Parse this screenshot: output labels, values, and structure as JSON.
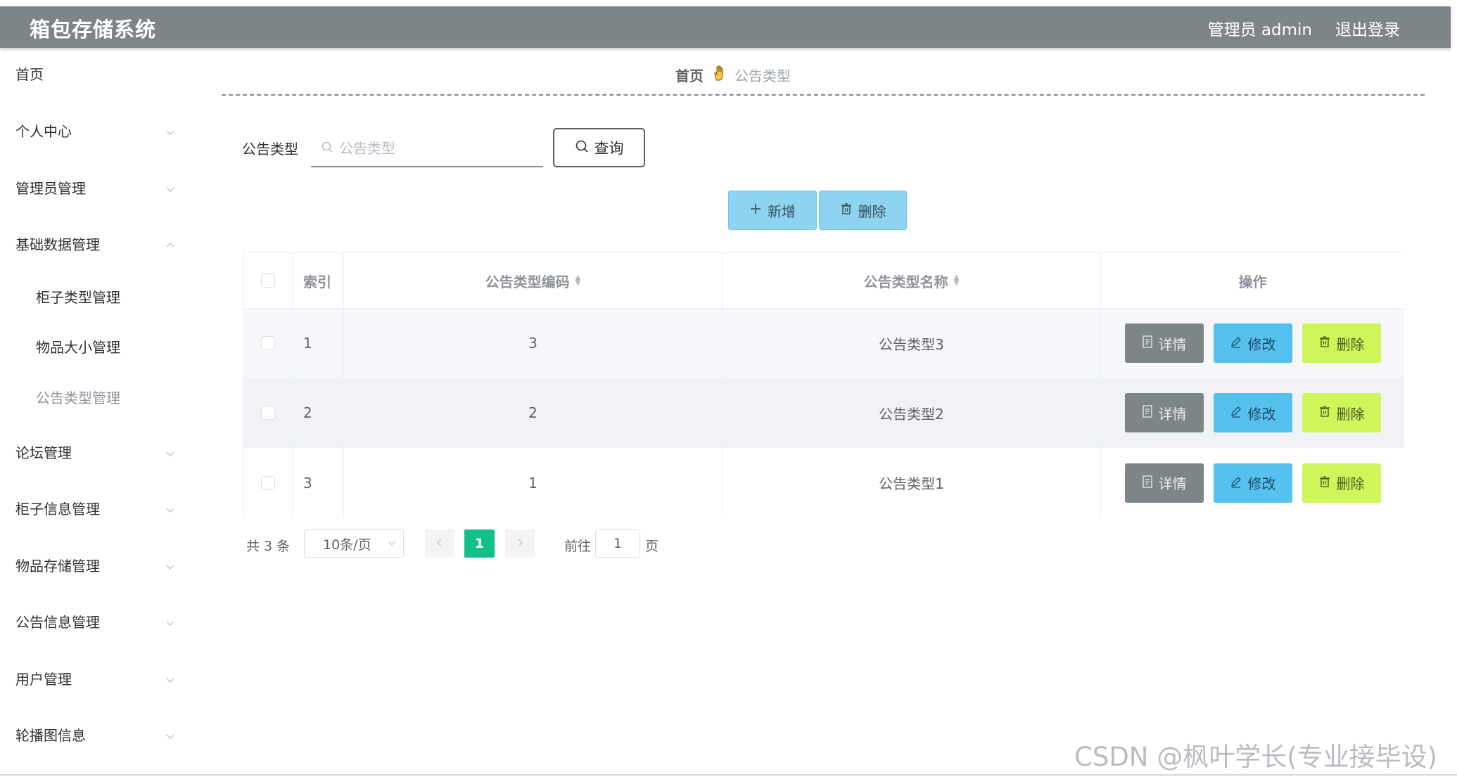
{
  "header": {
    "brand": "箱包存储系统",
    "user": "管理员 admin",
    "logout": "退出登录",
    "bg_color": "#7d8589"
  },
  "sidebar": {
    "items": [
      {
        "label": "首页",
        "chevron": false
      },
      {
        "label": "个人中心",
        "chevron": "down"
      },
      {
        "label": "管理员管理",
        "chevron": "down"
      },
      {
        "label": "基础数据管理",
        "chevron": "up"
      },
      {
        "label": "论坛管理",
        "chevron": "down"
      },
      {
        "label": "柜子信息管理",
        "chevron": "down"
      },
      {
        "label": "物品存储管理",
        "chevron": "down"
      },
      {
        "label": "公告信息管理",
        "chevron": "down"
      },
      {
        "label": "用户管理",
        "chevron": "down"
      },
      {
        "label": "轮播图信息",
        "chevron": "down"
      }
    ],
    "submenu": [
      {
        "label": "柜子类型管理",
        "active": false
      },
      {
        "label": "物品大小管理",
        "active": false
      },
      {
        "label": "公告类型管理",
        "active": true
      }
    ]
  },
  "breadcrumb": {
    "home": "首页",
    "current": "公告类型"
  },
  "search": {
    "label": "公告类型",
    "placeholder": "公告类型",
    "value": "",
    "query_label": "查询"
  },
  "toolbar": {
    "add_label": "新增",
    "delete_label": "删除",
    "button_color": "#8ed3ef"
  },
  "table": {
    "columns": [
      "索引",
      "公告类型编码",
      "公告类型名称",
      "操作"
    ],
    "rows": [
      {
        "index": "1",
        "code": "3",
        "name": "公告类型3"
      },
      {
        "index": "2",
        "code": "2",
        "name": "公告类型2"
      },
      {
        "index": "3",
        "code": "1",
        "name": "公告类型1"
      }
    ],
    "actions": {
      "detail": "详情",
      "edit": "修改",
      "delete": "删除"
    },
    "action_colors": {
      "detail": "#7d8589",
      "edit": "#56c0ef",
      "delete": "#cdf65a"
    }
  },
  "pagination": {
    "total": "共 3 条",
    "page_size": "10条/页",
    "current_page": "1",
    "goto_label": "前往",
    "goto_value": "1",
    "page_suffix": "页",
    "active_color": "#14c08a"
  },
  "watermark": "CSDN @枫叶学长(专业接毕设)"
}
